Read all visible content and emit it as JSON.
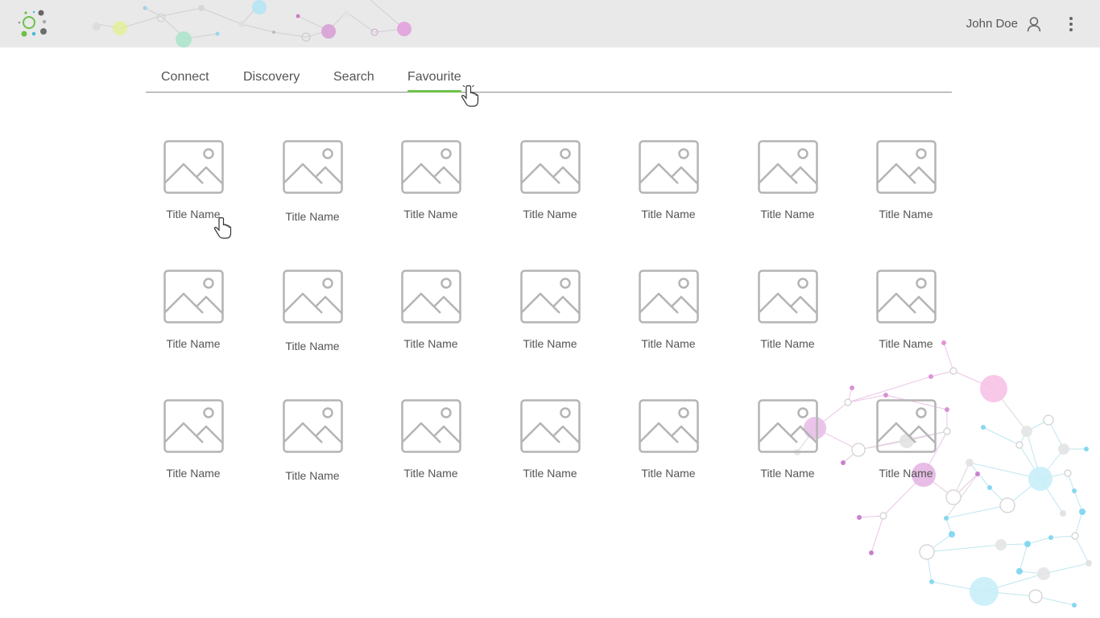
{
  "header": {
    "user_name": "John Doe",
    "logo_icon": "logo-icon",
    "user_icon": "user-icon",
    "more_icon": "more-vertical-icon"
  },
  "tabs": [
    {
      "label": "Connect",
      "active": false
    },
    {
      "label": "Discovery",
      "active": false
    },
    {
      "label": "Search",
      "active": false
    },
    {
      "label": "Favourite",
      "active": true
    }
  ],
  "colors": {
    "accent": "#6cc04a",
    "header_bg": "#e9e9e9",
    "text": "#555555",
    "placeholder": "#b4b4b4"
  },
  "grid": {
    "rows": [
      [
        "Title Name",
        "Title Name",
        "Title Name",
        "Title Name",
        "Title Name",
        "Title Name",
        "Title Name"
      ],
      [
        "Title Name",
        "Title Name",
        "Title Name",
        "Title Name",
        "Title Name",
        "Title Name",
        "Title Name"
      ],
      [
        "Title Name",
        "Title Name",
        "Title Name",
        "Title Name",
        "Title Name",
        "Title Name",
        "Title Name"
      ]
    ],
    "thumbnail_icon": "image-placeholder-icon"
  }
}
